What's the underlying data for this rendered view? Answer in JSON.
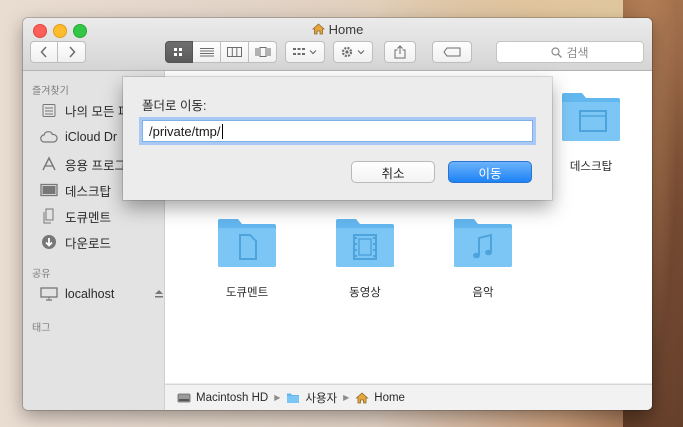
{
  "window": {
    "title": "Home"
  },
  "toolbar": {
    "back_icon": "chevron-left-icon",
    "forward_icon": "chevron-right-icon",
    "search_placeholder": "검색"
  },
  "sidebar": {
    "favorites_header": "즐겨찾기",
    "favorites": [
      {
        "label": "나의 모든 파",
        "icon": "all-files-icon"
      },
      {
        "label": "iCloud Dr",
        "icon": "cloud-icon"
      },
      {
        "label": "응용 프로그",
        "icon": "applications-icon"
      },
      {
        "label": "데스크탑",
        "icon": "desktop-icon"
      },
      {
        "label": "도큐멘트",
        "icon": "documents-icon"
      },
      {
        "label": "다운로드",
        "icon": "downloads-icon"
      }
    ],
    "shared_header": "공유",
    "shared": [
      {
        "label": "localhost",
        "icon": "display-icon"
      }
    ],
    "tags_header": "태그"
  },
  "content": {
    "folders": [
      {
        "label": "데스크탑",
        "icon": "desktop-folder-icon"
      },
      {
        "label": "도큐멘트",
        "icon": "documents-folder-icon"
      },
      {
        "label": "동영상",
        "icon": "movies-folder-icon"
      },
      {
        "label": "음악",
        "icon": "music-folder-icon"
      }
    ]
  },
  "pathbar": {
    "items": [
      {
        "label": "Macintosh HD",
        "icon": "hard-drive-icon"
      },
      {
        "label": "사용자",
        "icon": "folder-icon"
      },
      {
        "label": "Home",
        "icon": "home-icon"
      }
    ]
  },
  "dialog": {
    "label": "폴더로 이동:",
    "input_value": "/private/tmp/",
    "cancel_label": "취소",
    "go_label": "이동"
  },
  "colors": {
    "accent": "#1d82f5",
    "folder": "#63b7ef"
  }
}
